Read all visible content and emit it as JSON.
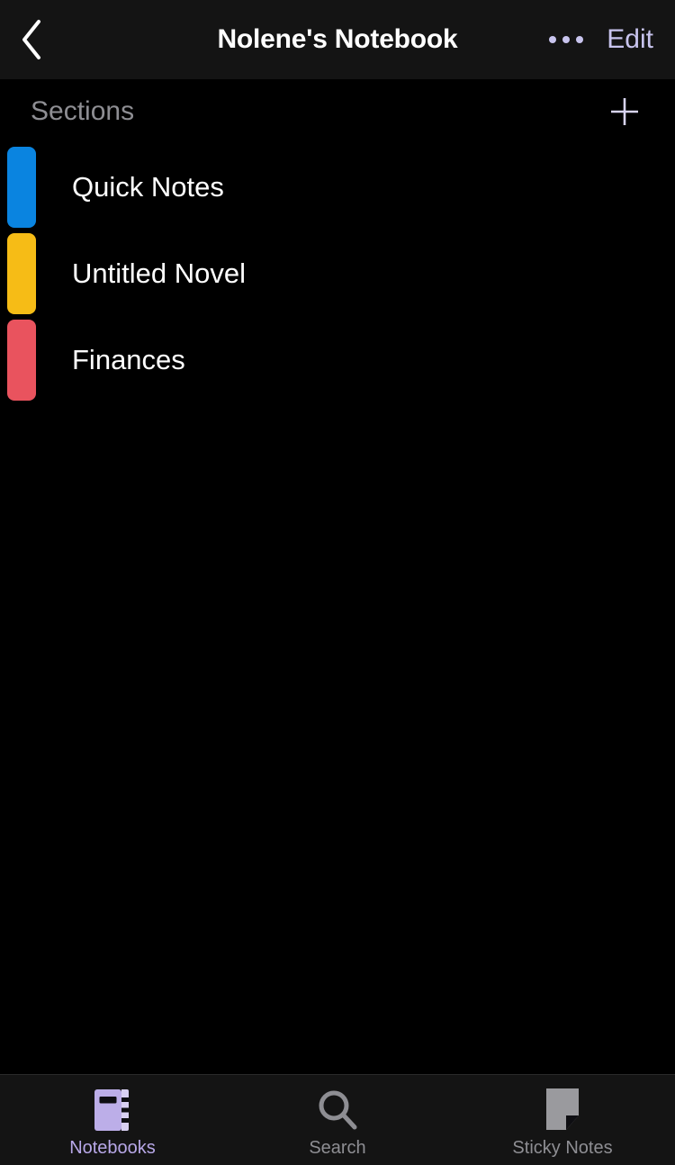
{
  "navbar": {
    "back_icon": "chevron-left-icon",
    "title": "Nolene's Notebook",
    "more_icon": "ellipsis-icon",
    "edit_label": "Edit",
    "accent_color": "#C8C4EE",
    "background": "#141414"
  },
  "sections_header": {
    "title": "Sections",
    "title_color": "#8E8E93",
    "add_icon": "plus-icon"
  },
  "sections": [
    {
      "label": "Quick Notes",
      "color": "#0A84E0"
    },
    {
      "label": "Untitled Novel",
      "color": "#F6BC16"
    },
    {
      "label": "Finances",
      "color": "#E9535E"
    }
  ],
  "tabbar": {
    "background": "#141414",
    "active_color": "#B8A8E8",
    "inactive_color": "#8E8E93",
    "items": [
      {
        "label": "Notebooks",
        "icon": "notebook-icon",
        "active": true
      },
      {
        "label": "Search",
        "icon": "search-icon",
        "active": false
      },
      {
        "label": "Sticky Notes",
        "icon": "sticky-note-icon",
        "active": false
      }
    ]
  }
}
